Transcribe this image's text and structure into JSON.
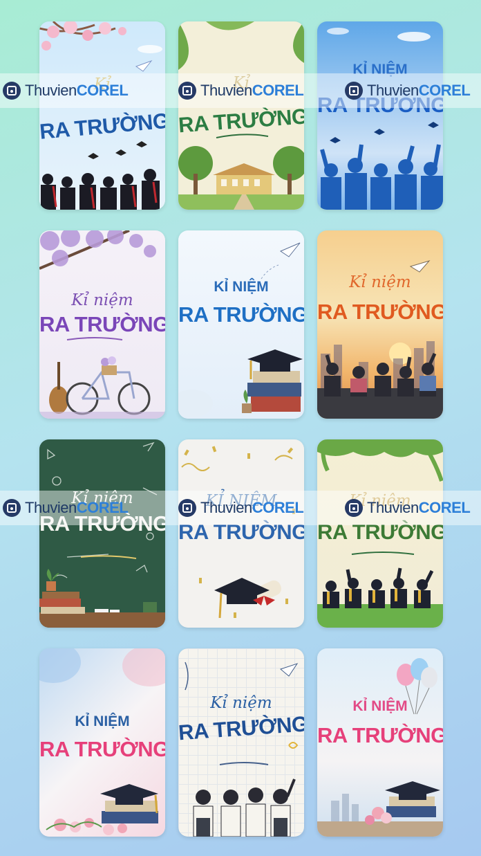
{
  "cards": [
    {
      "line1": "Kỉ",
      "line2": "RA TRƯỜNG"
    },
    {
      "line1": "Kỉ",
      "line2": "RA TRƯỜNG"
    },
    {
      "line1": "KỈ NIỆM",
      "line2": "RA TRƯỜNG"
    },
    {
      "line1": "Kỉ niệm",
      "line2": "RA TRƯỜNG"
    },
    {
      "line1": "KỈ NIỆM",
      "line2": "RA TRƯỜNG"
    },
    {
      "line1": "Kỉ niệm",
      "line2": "RA TRƯỜNG"
    },
    {
      "line1": "Kỉ niệm",
      "line2": "RA TRƯỜNG"
    },
    {
      "line1": "KỈ NIỆM",
      "line2": "RA TRƯỜNG"
    },
    {
      "line1": "Kỉ niệm",
      "line2": "RA TRƯỜNG"
    },
    {
      "line1": "KỈ NIỆM",
      "line2": "RA TRƯỜNG"
    },
    {
      "line1": "Kỉ niệm",
      "line2": "RA TRƯỜNG"
    },
    {
      "line1": "KỈ NIỆM",
      "line2": "RA TRƯỜNG"
    }
  ],
  "watermark": {
    "part1": "Thuvien",
    "part2": "COREL"
  },
  "colors": {
    "watermark_dark": "#1f3a66",
    "watermark_blue": "#2d7fd8"
  }
}
